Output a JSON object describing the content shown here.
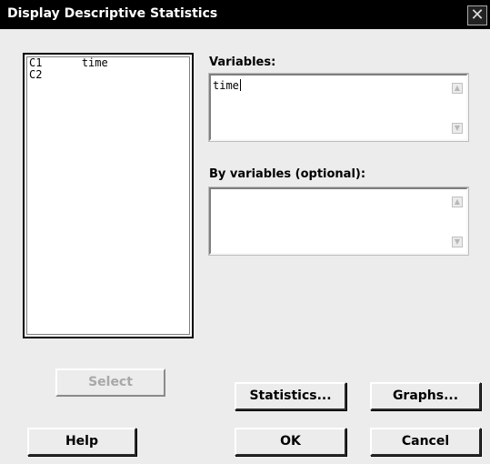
{
  "window": {
    "title": "Display Descriptive Statistics",
    "close_symbol": "✕"
  },
  "column_list": {
    "items": [
      {
        "id": "C1",
        "name": "time"
      },
      {
        "id": "C2",
        "name": ""
      }
    ]
  },
  "variables": {
    "label": "Variables:",
    "value": "time"
  },
  "by_variables": {
    "label": "By variables (optional):",
    "value": ""
  },
  "buttons": {
    "select": "Select",
    "statistics": "Statistics...",
    "graphs": "Graphs...",
    "help": "Help",
    "ok": "OK",
    "cancel": "Cancel"
  },
  "icons": {
    "scroll_up": "▲",
    "scroll_down": "▼"
  }
}
